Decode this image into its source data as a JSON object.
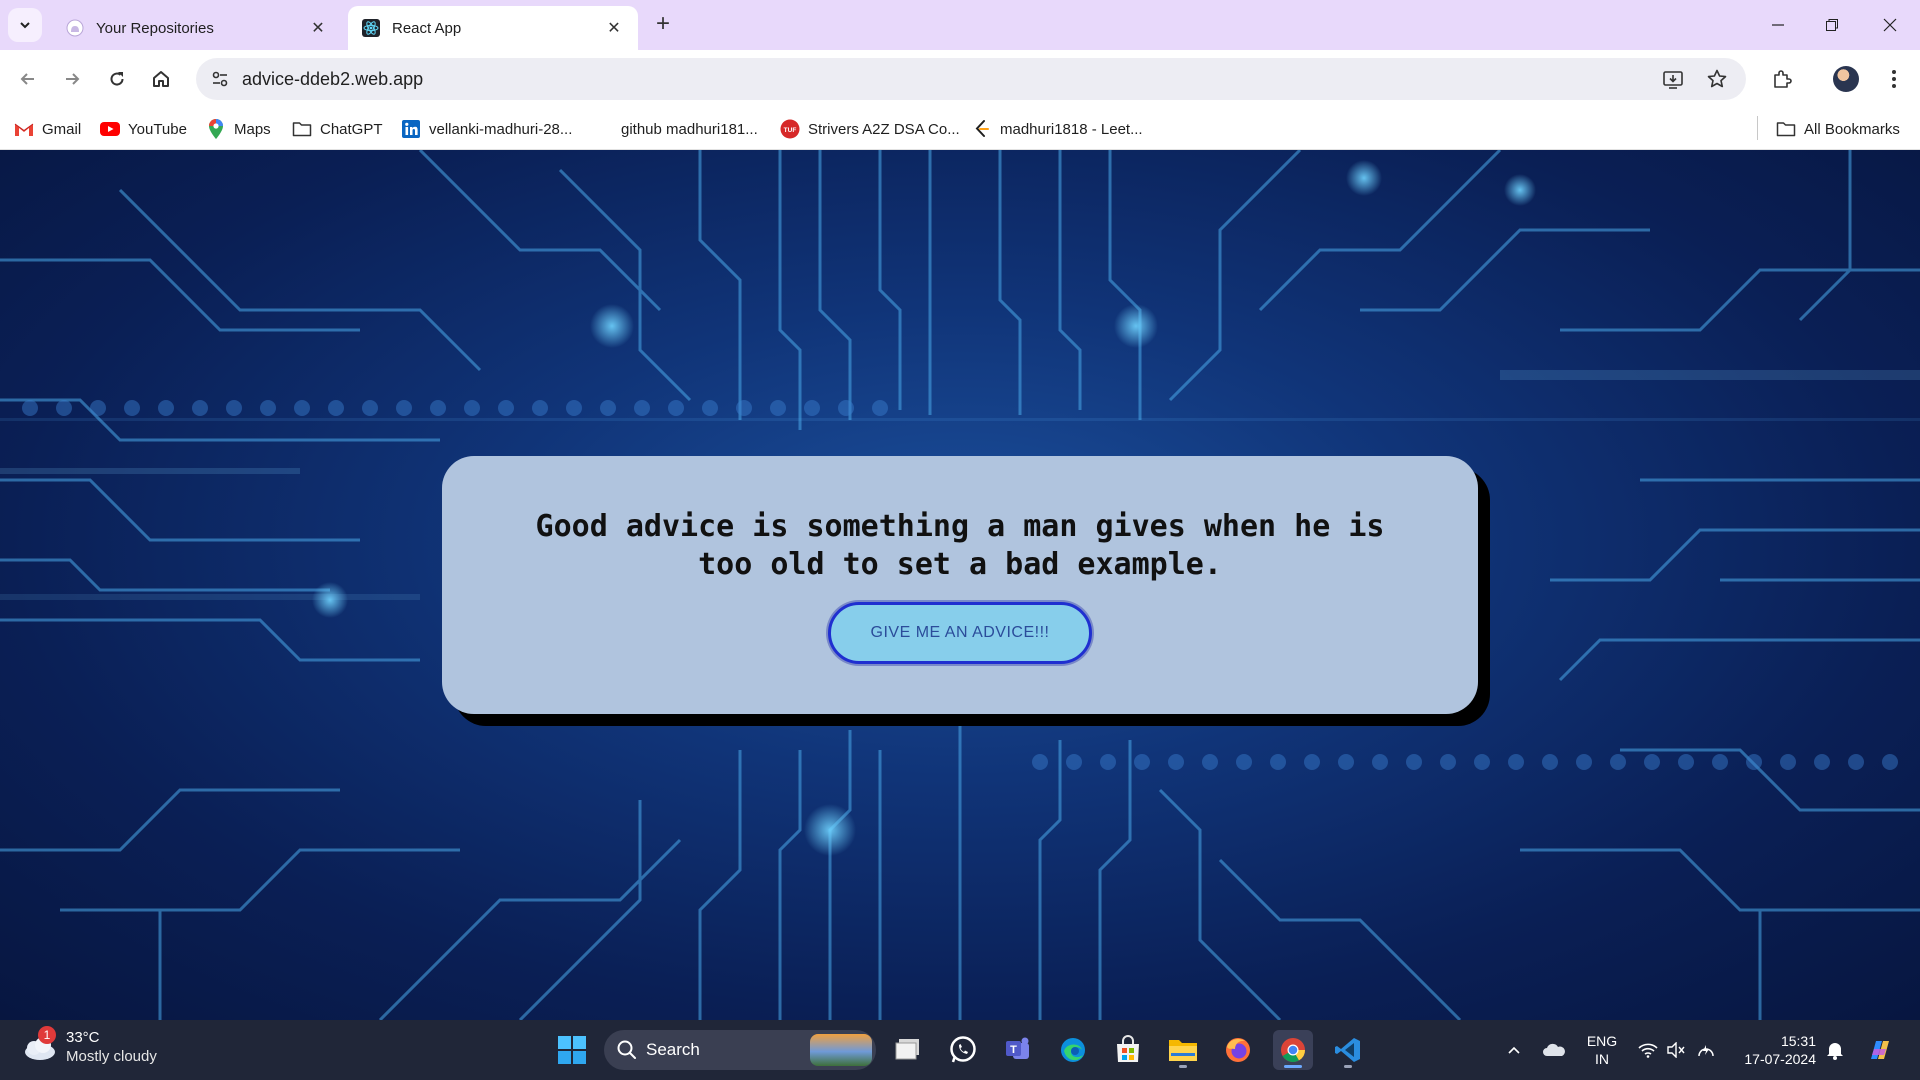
{
  "browser": {
    "tabs": [
      {
        "title": "Your Repositories",
        "active": false,
        "favicon": "github-icon"
      },
      {
        "title": "React App",
        "active": true,
        "favicon": "react-icon"
      }
    ],
    "url": "advice-ddeb2.web.app"
  },
  "bookmarks": [
    {
      "label": "Gmail",
      "icon": "gmail-icon"
    },
    {
      "label": "YouTube",
      "icon": "youtube-icon"
    },
    {
      "label": "Maps",
      "icon": "maps-icon"
    },
    {
      "label": "ChatGPT",
      "icon": "folder-icon"
    },
    {
      "label": "vellanki-madhuri-28...",
      "icon": "linkedin-icon"
    },
    {
      "label": "github madhuri181...",
      "icon": ""
    },
    {
      "label": "Strivers A2Z DSA Co...",
      "icon": "tuf-icon"
    },
    {
      "label": "madhuri1818 - Leet...",
      "icon": "leetcode-icon"
    }
  ],
  "all_bookmarks": "All Bookmarks",
  "app": {
    "advice": "Good advice is something a man gives when he is too old to set a bad example.",
    "button_label": "GIVE ME AN ADVICE!!!",
    "card_color": "#b0c4de",
    "button_color": "#87ceeb"
  },
  "taskbar": {
    "weather_temp": "33°C",
    "weather_desc": "Mostly cloudy",
    "weather_badge": "1",
    "search_label": "Search",
    "lang_line1": "ENG",
    "lang_line2": "IN",
    "time": "15:31",
    "date": "17-07-2024"
  }
}
